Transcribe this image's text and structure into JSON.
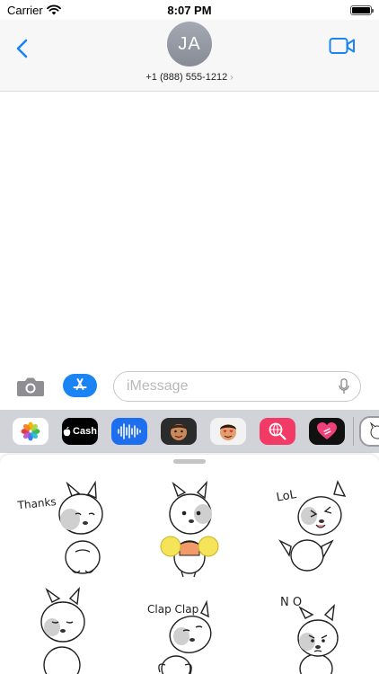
{
  "status_bar": {
    "carrier": "Carrier",
    "time": "8:07 PM"
  },
  "header": {
    "avatar_initials": "JA",
    "contact_number": "+1 (888) 555-1212",
    "contact_chevron": "›"
  },
  "composer": {
    "placeholder": "iMessage"
  },
  "app_drawer": {
    "apple_cash_label": "Cash"
  },
  "stickers": [
    {
      "caption": "Thanks"
    },
    {
      "caption": ""
    },
    {
      "caption": "LoL"
    },
    {
      "caption": ""
    },
    {
      "caption": "Clap   Clap"
    },
    {
      "caption": "N   O"
    }
  ],
  "colors": {
    "accent": "#1a84f5",
    "header_bg": "#f7f7f7",
    "drawer_bg": "#d1d3d9",
    "heart_bg": "#f0407a"
  }
}
